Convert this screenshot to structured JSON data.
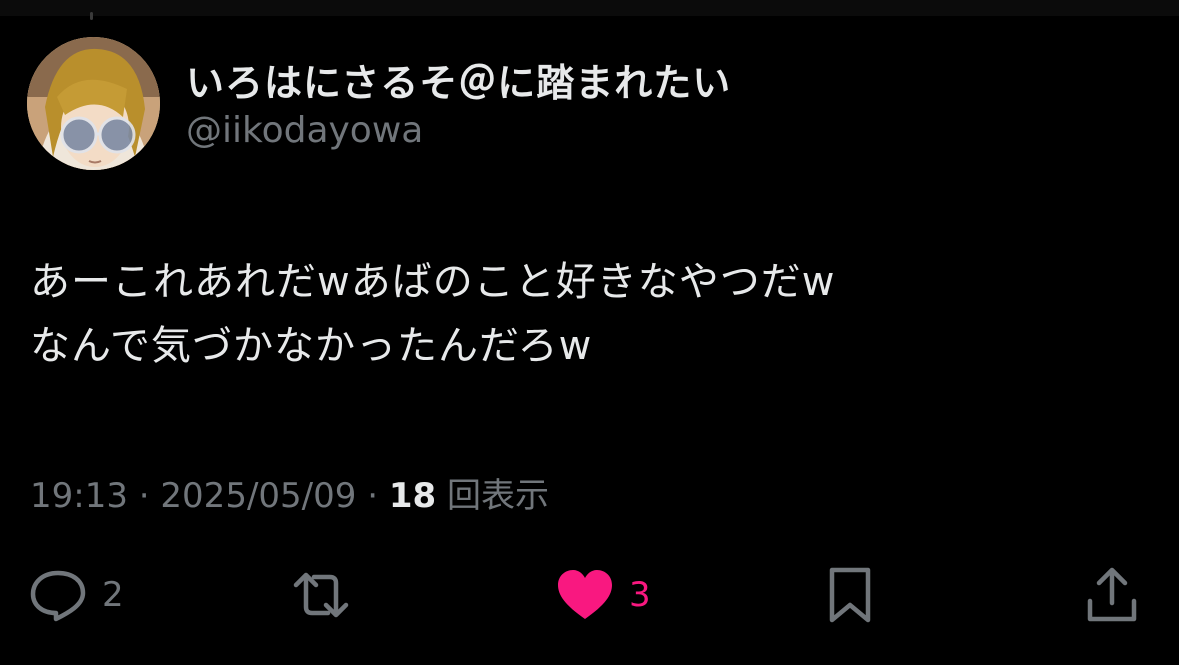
{
  "user": {
    "display_name": "いろはにさるそ＠に踏まれたい",
    "handle": "@iikodayowa",
    "avatar_icon": "avatar-image"
  },
  "tweet": {
    "lines": [
      "あーこれあれだwあばのこと好きなやつだw",
      "なんで気づかなかったんだろw"
    ]
  },
  "meta": {
    "time": "19:13",
    "separator1": " · ",
    "date": "2025/05/09",
    "separator2": " · ",
    "views_count": "18",
    "views_label": "回表示"
  },
  "actions": {
    "reply": {
      "icon": "reply-icon",
      "count": "2"
    },
    "retweet": {
      "icon": "retweet-icon",
      "count": ""
    },
    "like": {
      "icon": "heart-icon",
      "count": "3",
      "color": "#f91880"
    },
    "bookmark": {
      "icon": "bookmark-icon"
    },
    "share": {
      "icon": "share-icon"
    }
  },
  "colors": {
    "background": "#000000",
    "text_primary": "#e7e9ea",
    "text_secondary": "#71767b",
    "like_pink": "#f91880"
  }
}
